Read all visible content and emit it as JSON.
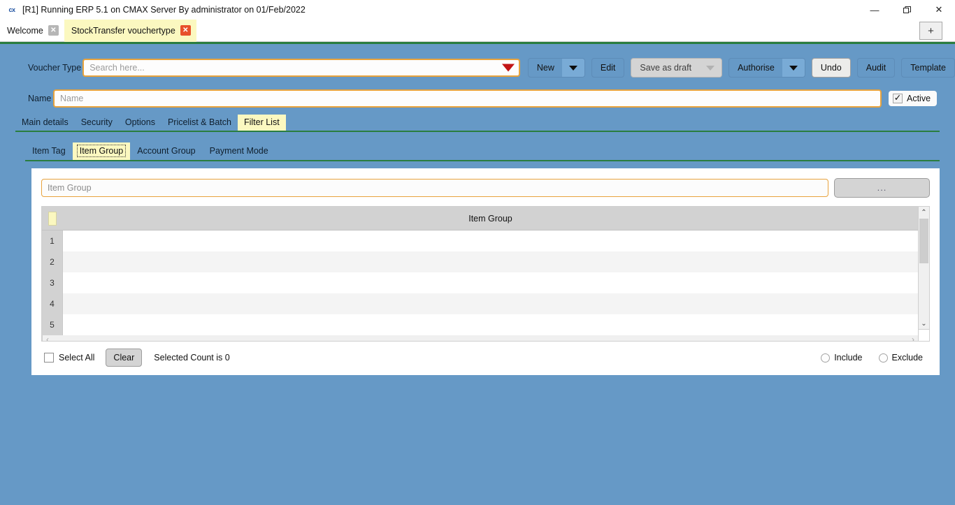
{
  "window": {
    "title": "[R1] Running ERP 5.1 on CMAX Server By administrator on 01/Feb/2022",
    "logo": "cx",
    "minimize": "—",
    "maximize": "❐",
    "close": "✕"
  },
  "tabstrip": {
    "tabs": [
      {
        "label": "Welcome",
        "close": "✕",
        "active": false
      },
      {
        "label": "StockTransfer vouchertype",
        "close": "✕",
        "active": true
      }
    ],
    "add_label": "+"
  },
  "form": {
    "voucher_type_label": "Voucher Type",
    "voucher_type_placeholder": "Search here...",
    "voucher_type_value": "",
    "name_label": "Name",
    "name_placeholder": "Name",
    "name_value": "",
    "active_label": "Active",
    "active_checked": true,
    "active_check_glyph": "✓"
  },
  "toolbar": {
    "new_label": "New",
    "edit_label": "Edit",
    "save_as_draft_label": "Save as draft",
    "authorise_label": "Authorise",
    "undo_label": "Undo",
    "audit_label": "Audit",
    "template_label": "Template"
  },
  "primary_tabs": [
    {
      "label": "Main details",
      "active": false
    },
    {
      "label": "Security",
      "active": false
    },
    {
      "label": "Options",
      "active": false
    },
    {
      "label": "Pricelist & Batch",
      "active": false
    },
    {
      "label": "Filter List",
      "active": true
    }
  ],
  "sub_tabs": [
    {
      "label": "Item Tag",
      "active": false
    },
    {
      "label": "Item Group",
      "active": true
    },
    {
      "label": "Account Group",
      "active": false
    },
    {
      "label": "Payment Mode",
      "active": false
    }
  ],
  "panel": {
    "item_group_placeholder": "Item Group",
    "item_group_value": "",
    "ellipsis_label": "...",
    "grid": {
      "column_header": "Item Group",
      "rows": [
        {
          "number": "1",
          "value": ""
        },
        {
          "number": "2",
          "value": ""
        },
        {
          "number": "3",
          "value": ""
        },
        {
          "number": "4",
          "value": ""
        },
        {
          "number": "5",
          "value": ""
        }
      ]
    },
    "scrollbar": {
      "up": "⌃",
      "down": "⌄",
      "left": "‹",
      "right": "›"
    },
    "footer": {
      "select_all_label": "Select All",
      "select_all_checked": false,
      "clear_label": "Clear",
      "selected_count_text": "Selected Count is 0",
      "include_label": "Include",
      "include_selected": false,
      "exclude_label": "Exclude",
      "exclude_selected": false
    }
  },
  "colors": {
    "workspace_blue": "#6699c6",
    "accent_green": "#2a7d3f",
    "tab_yellow": "#fbf8c0",
    "field_border_orange": "#e8a33d",
    "dropdown_red": "#c21515",
    "tab_close_red": "#e8502a"
  }
}
